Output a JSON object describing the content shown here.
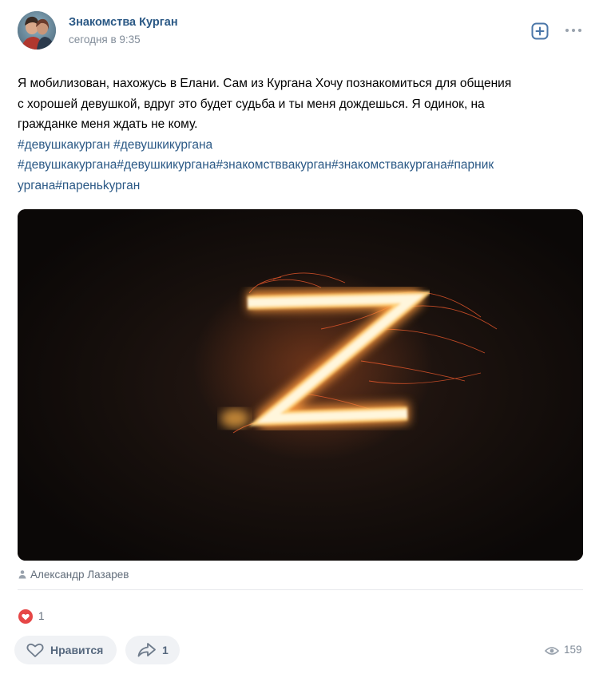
{
  "post": {
    "group_name": "Знакомства Курган",
    "time": "сегодня в 9:35",
    "text_lines": [
      "Я мобилизован, нахожусь в Елани. Сам из Кургана Хочу познакомиться для общения",
      "с хорошей девушкой, вдруг это будет судьба и ты меня дождешься. Я одинок, на",
      "гражданке меня ждать не кому."
    ],
    "hashtag_line_1": [
      "#девушкакурган",
      "#девушкикургана"
    ],
    "hashtag_line_2": "#девушкакургана#девушкикургана#знакомстввакурган#знакомствакургана#парник",
    "hashtag_line_3": "ургана#пареньkурган",
    "author": "Александр Лазарев",
    "reactions_count": "1",
    "like_label": "Нравится",
    "share_count": "1",
    "views_count": "159"
  },
  "icons": {
    "avatar": "avatar-image",
    "subscribe": "plus-square-icon",
    "more": "more-dots-icon",
    "author": "person-icon",
    "reaction": "heart-reaction-icon",
    "like": "heart-outline-icon",
    "share": "share-arrow-icon",
    "views": "eye-icon"
  },
  "colors": {
    "link": "#2a5885",
    "accent": "#4a76a8",
    "reaction": "#e64646",
    "muted": "#818c99"
  }
}
